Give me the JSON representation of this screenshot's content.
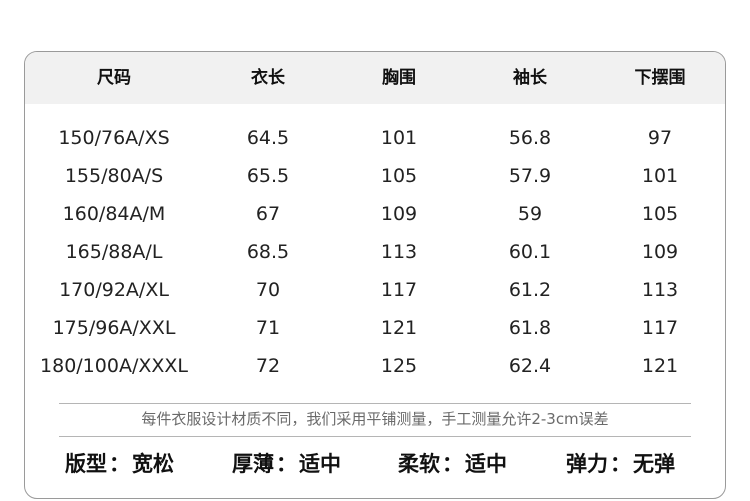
{
  "table": {
    "headers": [
      "尺码",
      "衣长",
      "胸围",
      "袖长",
      "下摆围"
    ],
    "rows": [
      [
        "150/76A/XS",
        "64.5",
        "101",
        "56.8",
        "97"
      ],
      [
        "155/80A/S",
        "65.5",
        "105",
        "57.9",
        "101"
      ],
      [
        "160/84A/M",
        "67",
        "109",
        "59",
        "105"
      ],
      [
        "165/88A/L",
        "68.5",
        "113",
        "60.1",
        "109"
      ],
      [
        "170/92A/XL",
        "70",
        "117",
        "61.2",
        "113"
      ],
      [
        "175/96A/XXL",
        "71",
        "121",
        "61.8",
        "117"
      ],
      [
        "180/100A/XXXL",
        "72",
        "125",
        "62.4",
        "121"
      ]
    ]
  },
  "note": "每件衣服设计材质不同，我们采用平铺测量，手工测量允许2-3cm误差",
  "attributes": [
    {
      "label": "版型",
      "value": "宽松"
    },
    {
      "label": "厚薄",
      "value": "适中"
    },
    {
      "label": "柔软",
      "value": "适中"
    },
    {
      "label": "弹力",
      "value": "无弹"
    }
  ],
  "separator": "：",
  "colors": {
    "header_background": "#f1f1f1",
    "border": "#9a9a9a",
    "note_text": "#6a6a6a",
    "text": "#1a1a1a"
  }
}
